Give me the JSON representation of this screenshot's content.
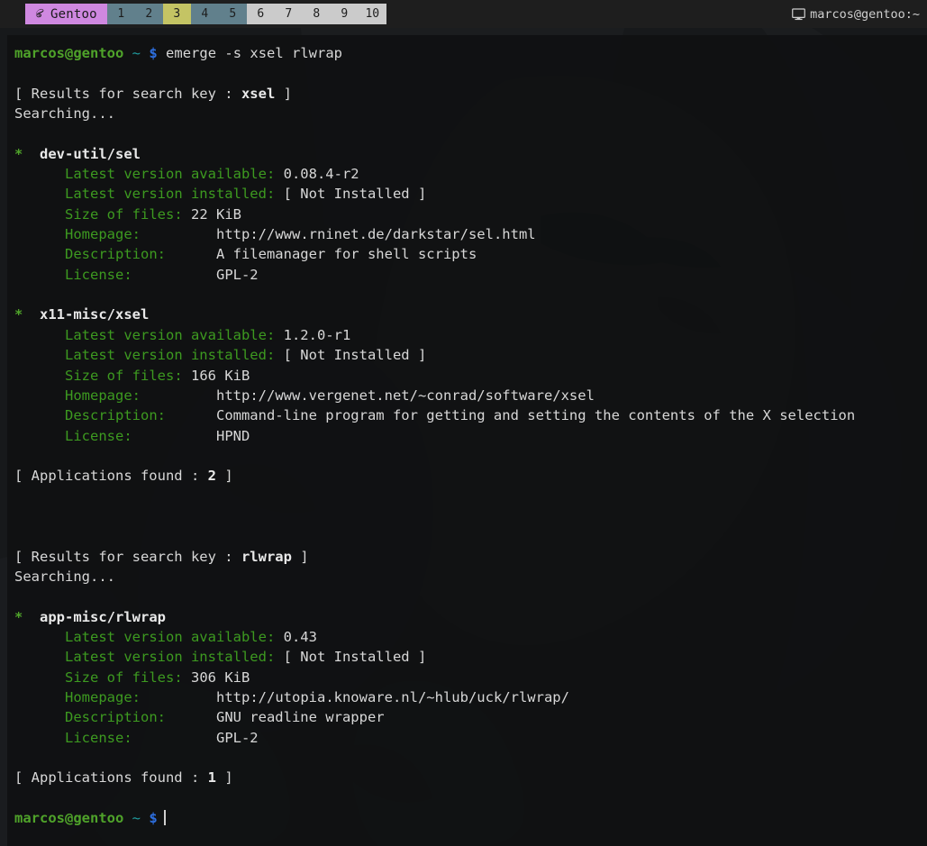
{
  "taskbar": {
    "launcher": {
      "label": "Gentoo",
      "icon": "gentoo-logo-icon"
    },
    "workspaces": [
      {
        "label": "1",
        "state": "inactive-a"
      },
      {
        "label": "2",
        "state": "inactive-a"
      },
      {
        "label": "3",
        "state": "active"
      },
      {
        "label": "4",
        "state": "inactive-a"
      },
      {
        "label": "5",
        "state": "inactive-a"
      },
      {
        "label": "6",
        "state": "inactive-b"
      },
      {
        "label": "7",
        "state": "inactive-b"
      },
      {
        "label": "8",
        "state": "inactive-b"
      },
      {
        "label": "9",
        "state": "inactive-b"
      },
      {
        "label": "10",
        "state": "inactive-b"
      }
    ],
    "window_title": "marcos@gentoo:~",
    "window_icon": "monitor-icon",
    "colors": {
      "bar_bg": "#1e1e1e",
      "launcher_bg": "#cf88e0",
      "ws_inactive_a": "#61808c",
      "ws_active": "#c4c464",
      "ws_inactive_b": "#cbcbcb",
      "border": "#8f2019"
    }
  },
  "terminal": {
    "prompt": {
      "user_host": "marcos@gentoo",
      "path": "~",
      "symbol": "$"
    },
    "command": "emerge -s xsel rlwrap",
    "searches": [
      {
        "header_prefix": "[ Results for search key : ",
        "key": "xsel",
        "header_suffix": " ]",
        "searching": "Searching...",
        "packages": [
          {
            "marker": "*",
            "name": "dev-util/sel",
            "fields": [
              {
                "label": "Latest version available:",
                "value": "0.08.4-r2",
                "pad": 1
              },
              {
                "label": "Latest version installed:",
                "value": "[ Not Installed ]",
                "pad": 1
              },
              {
                "label": "Size of files:",
                "value": "22 KiB",
                "pad": 1
              },
              {
                "label": "Homepage:",
                "value": "http://www.rninet.de/darkstar/sel.html",
                "pad": 9
              },
              {
                "label": "Description:",
                "value": "A filemanager for shell scripts",
                "pad": 6
              },
              {
                "label": "License:",
                "value": "GPL-2",
                "pad": 10
              }
            ]
          },
          {
            "marker": "*",
            "name": "x11-misc/xsel",
            "fields": [
              {
                "label": "Latest version available:",
                "value": "1.2.0-r1",
                "pad": 1
              },
              {
                "label": "Latest version installed:",
                "value": "[ Not Installed ]",
                "pad": 1
              },
              {
                "label": "Size of files:",
                "value": "166 KiB",
                "pad": 1
              },
              {
                "label": "Homepage:",
                "value": "http://www.vergenet.net/~conrad/software/xsel",
                "pad": 9
              },
              {
                "label": "Description:",
                "value": "Command-line program for getting and setting the contents of the X selection",
                "pad": 6
              },
              {
                "label": "License:",
                "value": "HPND",
                "pad": 10
              }
            ]
          }
        ],
        "footer_prefix": "[ Applications found : ",
        "found_count": "2",
        "footer_suffix": " ]"
      },
      {
        "header_prefix": "[ Results for search key : ",
        "key": "rlwrap",
        "header_suffix": " ]",
        "searching": "Searching...",
        "packages": [
          {
            "marker": "*",
            "name": "app-misc/rlwrap",
            "fields": [
              {
                "label": "Latest version available:",
                "value": "0.43",
                "pad": 1
              },
              {
                "label": "Latest version installed:",
                "value": "[ Not Installed ]",
                "pad": 1
              },
              {
                "label": "Size of files:",
                "value": "306 KiB",
                "pad": 1
              },
              {
                "label": "Homepage:",
                "value": "http://utopia.knoware.nl/~hlub/uck/rlwrap/",
                "pad": 9
              },
              {
                "label": "Description:",
                "value": "GNU readline wrapper",
                "pad": 6
              },
              {
                "label": "License:",
                "value": "GPL-2",
                "pad": 10
              }
            ]
          }
        ],
        "footer_prefix": "[ Applications found : ",
        "found_count": "1",
        "footer_suffix": " ]"
      }
    ],
    "colors": {
      "bg": "#101112",
      "fg": "#d7d7d7",
      "green_label": "#3d9a20",
      "prompt_user": "#4fa32a",
      "prompt_path": "#1f9ea0",
      "prompt_symbol": "#2d6fe0"
    }
  }
}
